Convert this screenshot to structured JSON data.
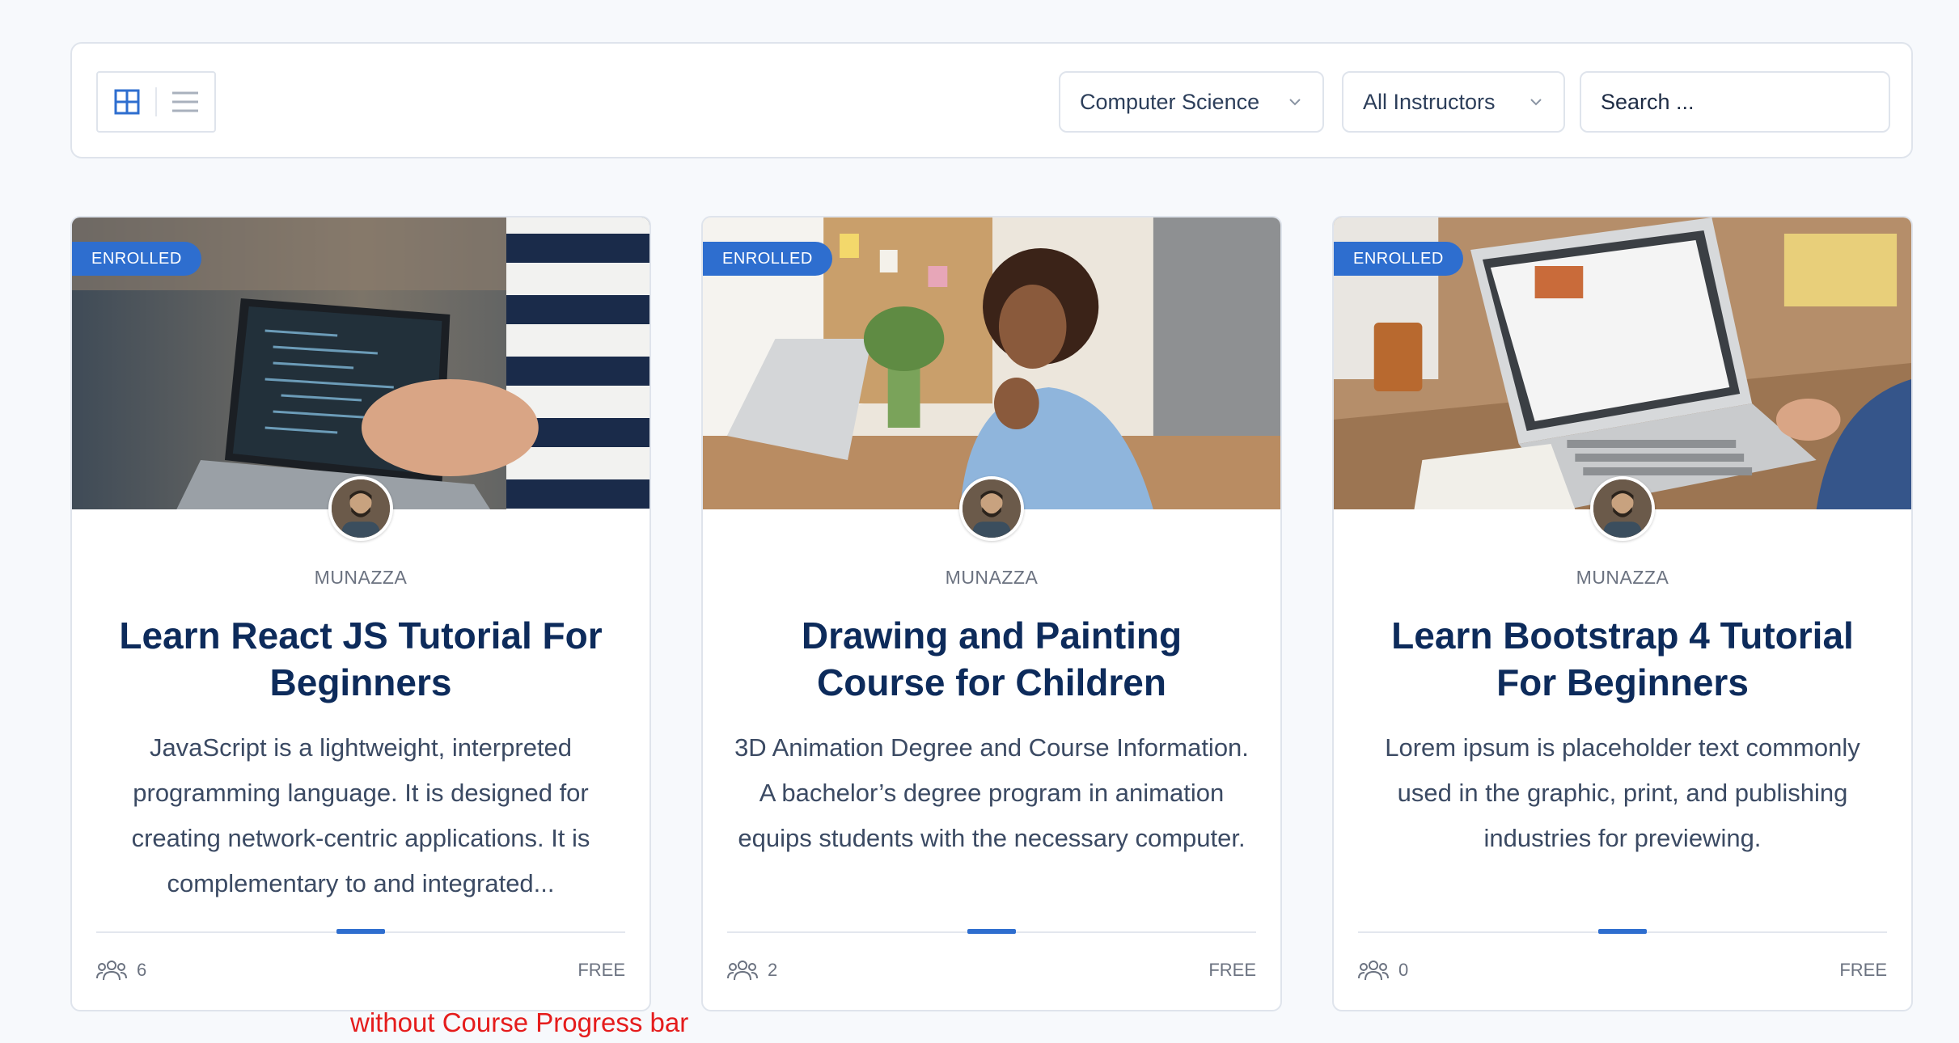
{
  "toolbar": {
    "view_modes": [
      "grid",
      "list"
    ],
    "active_view": "grid",
    "category_select": {
      "selected": "Computer Science"
    },
    "instructor_select": {
      "selected": "All Instructors"
    },
    "search": {
      "placeholder": "Search ...",
      "value": ""
    }
  },
  "courses": [
    {
      "badge": "ENROLLED",
      "instructor": "MUNAZZA",
      "title": "Learn React JS Tutorial For Beginners",
      "description": "JavaScript is a lightweight, interpreted programming language. It is designed for creating network-centric applications. It is complementary to and integrated...",
      "students": "6",
      "price": "FREE"
    },
    {
      "badge": "ENROLLED",
      "instructor": "MUNAZZA",
      "title": "Drawing and Painting Course for Children",
      "description": "3D Animation Degree and Course Information. A bachelor’s degree program in animation equips students with the necessary computer.",
      "students": "2",
      "price": "FREE"
    },
    {
      "badge": "ENROLLED",
      "instructor": "MUNAZZA",
      "title": "Learn Bootstrap 4 Tutorial For Beginners",
      "description": "Lorem ipsum is placeholder text commonly used in the graphic, print, and publishing industries for previewing.",
      "students": "0",
      "price": "FREE"
    }
  ],
  "annotation": "without Course Progress bar",
  "colors": {
    "accent": "#2e6ecf",
    "title": "#0d2b5b",
    "annotation": "#e51c1c",
    "border": "#dfe4ec"
  }
}
